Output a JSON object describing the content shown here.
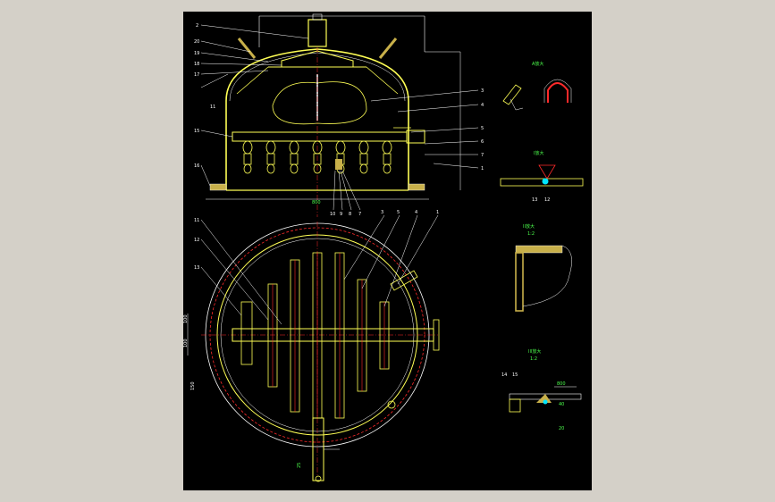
{
  "colors": {
    "background": "#d4d0c8",
    "sheet": "#000000",
    "outline": "#ffffff",
    "vessel": "#ffff55",
    "centerline": "#ff2a2a",
    "dimension": "#4cff4c",
    "nozzle_dark": "#c8b04a"
  },
  "front_view": {
    "leaders_left": [
      "2",
      "20",
      "19",
      "18",
      "17",
      "11",
      "15",
      "16"
    ],
    "leaders_right": [
      "3",
      "4",
      "5",
      "6",
      "7",
      "1"
    ],
    "bottom_labels": [
      "10",
      "9",
      "8",
      "7"
    ],
    "dims_right": [
      "1",
      "1",
      "1"
    ],
    "width_dim": "800"
  },
  "plan_view": {
    "leaders_top": [
      "11",
      "12",
      "13",
      "3",
      "5",
      "4",
      "1"
    ],
    "side_dims": [
      "100",
      "100",
      "150"
    ],
    "outlet_label": "25"
  },
  "details": {
    "detail_a_title": "A放大",
    "detail_b_title": "I放大",
    "detail_c_title": "II放大",
    "detail_d_title": "III放大",
    "scale": "1:2",
    "weld_labels": [
      "13",
      "12",
      "14",
      "15"
    ],
    "dims": [
      "800",
      "40",
      "20"
    ]
  },
  "icons": [
    "weld-symbol-icon",
    "flange-icon",
    "nozzle-icon"
  ]
}
